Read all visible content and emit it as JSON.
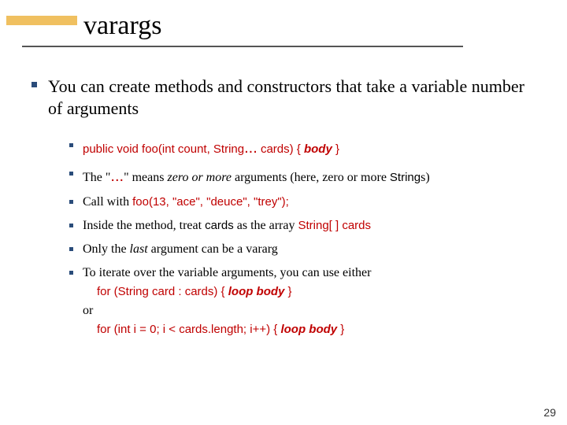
{
  "title": "varargs",
  "main": "You can create methods and constructors that take a variable number of arguments",
  "b1": {
    "lead": "public void foo(int count, String",
    "dots": "...",
    "tail": " cards) { ",
    "body": "body",
    "close": " }"
  },
  "b2": {
    "t1": "The \"",
    "dots": "...",
    "t2": "\" means ",
    "zom": "zero or more",
    "t3": " arguments (here, zero or more ",
    "str": "String",
    "t4": "s)"
  },
  "b3": {
    "t1": "Call with ",
    "code": "foo(13, \"ace\", \"deuce\", \"trey\");"
  },
  "b4": {
    "t1": "Inside the method, treat ",
    "c1": "cards",
    "t2": " as the array ",
    "c2": "String[ ] cards"
  },
  "b5": {
    "t1": "Only the ",
    "last": "last",
    "t2": " argument can be a vararg"
  },
  "b6": {
    "t1": "To iterate over the variable arguments, you can use either",
    "for1a": "for (String card : cards) { ",
    "lb": "loop body",
    "for1b": " }",
    "or": "or",
    "for2a": "for (int i = 0; i < cards.length; i++) { ",
    "for2b": " }"
  },
  "page": "29"
}
